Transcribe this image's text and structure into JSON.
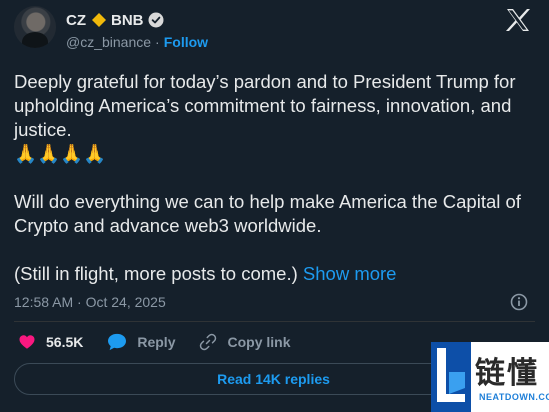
{
  "author": {
    "display_name": "CZ",
    "badge_name": "BNB",
    "handle": "@cz_binance",
    "separator": "·",
    "follow_label": "Follow"
  },
  "tweet": {
    "line1": "Deeply grateful for today’s pardon and to President Trump for upholding America’s commitment to fairness, innovation, and justice.",
    "emoji": "🙏🙏🙏🙏",
    "line2": "Will do everything we can to help make America the Capital of Crypto and advance web3 worldwide.",
    "line3": "(Still in flight, more posts to come.)",
    "show_more": "Show more"
  },
  "meta": {
    "timestamp": "12:58 AM · Oct 24, 2025"
  },
  "actions": {
    "like_count": "56.5K",
    "reply_label": "Reply",
    "copy_label": "Copy link"
  },
  "footer": {
    "read_replies": "Read 14K replies"
  },
  "watermark": {
    "cn_text": "链懂",
    "en_text": "NEATDOWN.COM"
  },
  "colors": {
    "background": "#15202b",
    "text": "#e7e9ea",
    "secondary": "#8b98a5",
    "accent": "#1d9bf0",
    "like": "#f91880",
    "bnb": "#f0b90b"
  },
  "icons": {
    "brand": "x-logo-icon",
    "badge": "bnb-diamond-icon",
    "verified": "verified-badge-icon",
    "info": "info-icon",
    "like": "heart-icon",
    "reply": "speech-bubble-icon",
    "copy": "link-icon"
  }
}
